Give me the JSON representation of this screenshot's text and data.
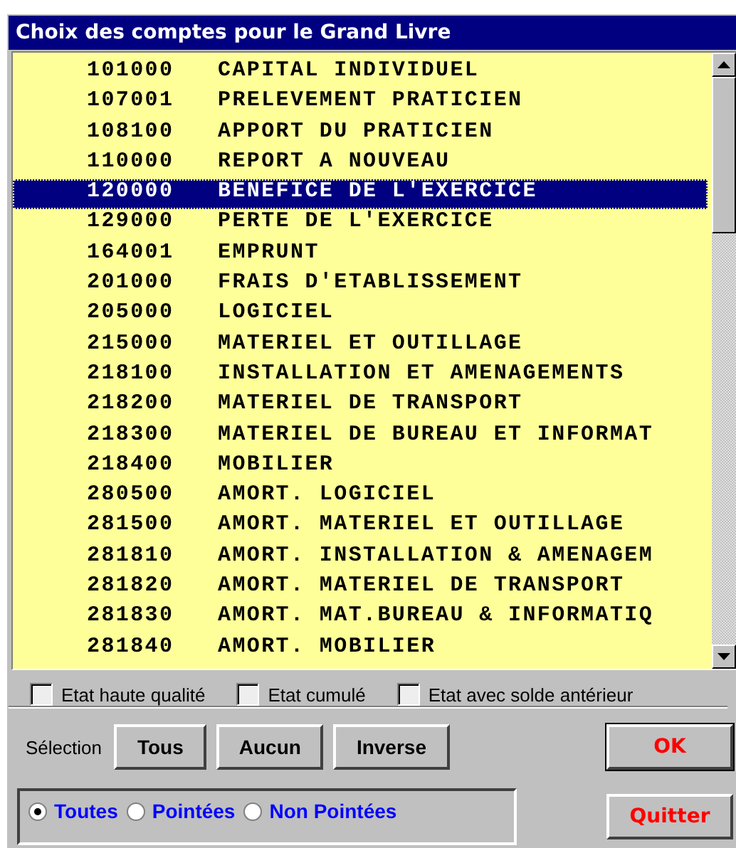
{
  "window": {
    "title": "Choix des comptes pour le Grand Livre"
  },
  "accounts": [
    {
      "code": "101000",
      "name": "CAPITAL INDIVIDUEL",
      "selected": false
    },
    {
      "code": "107001",
      "name": "PRELEVEMENT PRATICIEN",
      "selected": false
    },
    {
      "code": "108100",
      "name": "APPORT DU PRATICIEN",
      "selected": false
    },
    {
      "code": "110000",
      "name": "REPORT A NOUVEAU",
      "selected": false
    },
    {
      "code": "120000",
      "name": "BENEFICE DE L'EXERCICE",
      "selected": true
    },
    {
      "code": "129000",
      "name": "PERTE DE L'EXERCICE",
      "selected": false
    },
    {
      "code": "164001",
      "name": "EMPRUNT",
      "selected": false
    },
    {
      "code": "201000",
      "name": "FRAIS D'ETABLISSEMENT",
      "selected": false
    },
    {
      "code": "205000",
      "name": "LOGICIEL",
      "selected": false
    },
    {
      "code": "215000",
      "name": "MATERIEL ET OUTILLAGE",
      "selected": false
    },
    {
      "code": "218100",
      "name": "INSTALLATION ET AMENAGEMENTS",
      "selected": false
    },
    {
      "code": "218200",
      "name": "MATERIEL DE TRANSPORT",
      "selected": false
    },
    {
      "code": "218300",
      "name": "MATERIEL DE BUREAU ET INFORMAT",
      "selected": false
    },
    {
      "code": "218400",
      "name": "MOBILIER",
      "selected": false
    },
    {
      "code": "280500",
      "name": "AMORT. LOGICIEL",
      "selected": false
    },
    {
      "code": "281500",
      "name": "AMORT. MATERIEL ET OUTILLAGE",
      "selected": false
    },
    {
      "code": "281810",
      "name": "AMORT. INSTALLATION & AMENAGEM",
      "selected": false
    },
    {
      "code": "281820",
      "name": "AMORT. MATERIEL DE TRANSPORT",
      "selected": false
    },
    {
      "code": "281830",
      "name": "AMORT. MAT.BUREAU & INFORMATIQ",
      "selected": false
    },
    {
      "code": "281840",
      "name": "AMORT. MOBILIER",
      "selected": false
    }
  ],
  "options": [
    {
      "label": "Etat haute qualité",
      "checked": false
    },
    {
      "label": "Etat cumulé",
      "checked": false
    },
    {
      "label": "Etat avec solde antérieur",
      "checked": false
    }
  ],
  "selection": {
    "label": "Sélection",
    "buttons": [
      "Tous",
      "Aucun",
      "Inverse"
    ]
  },
  "filter": [
    {
      "label": "Toutes",
      "selected": true
    },
    {
      "label": "Pointées",
      "selected": false
    },
    {
      "label": "Non Pointées",
      "selected": false
    }
  ],
  "actions": [
    "OK",
    "Quitter"
  ]
}
